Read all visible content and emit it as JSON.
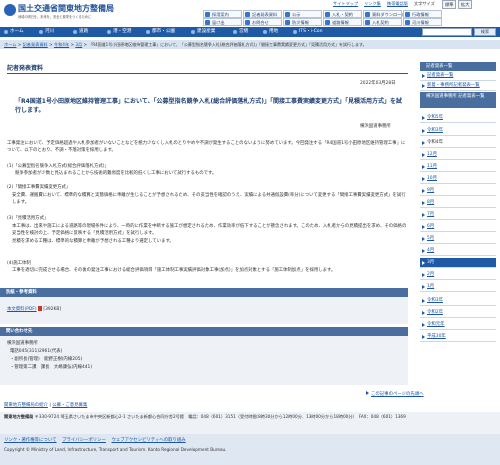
{
  "header": {
    "org_name": "国土交通省関東地方整備局",
    "tagline": "地域の明日を。未来を。安全と繁栄をつくるために",
    "util_links": [
      "サイトマップ",
      "リンク集",
      "携帯電話版"
    ],
    "font_size_label": "文字サイズ",
    "font_size_buttons": [
      "標準",
      "拡大"
    ],
    "buttons": [
      "採用案内",
      "記者発表資料",
      "公示",
      "入札・契約",
      "資料ダウンロード",
      "行政情報",
      "届け出",
      "お問合せ",
      "防災情報",
      "道路情報",
      "入札契約",
      "河川情報"
    ]
  },
  "nav": {
    "items": [
      "ホーム",
      "河川",
      "道路",
      "港・空港",
      "都市・公園",
      "建設産業",
      "営繕",
      "用地",
      "ITS・i-Con"
    ],
    "search_button": "検索"
  },
  "breadcrumb": [
    "ホーム",
    "記者発表資料",
    "令和4年",
    "3月",
    "「R4国道1号小田原地区維持管理工事」において、「公募型指名競争入札(総合評価落札方式)」「間接工事費実績変更方式」「見積活用方式」を試行します。"
  ],
  "main": {
    "section_title": "記者発表資料",
    "date": "2022年03月28日",
    "title": "「R4国道1号小田原地区維持管理工事」において、「公募型指名競争入札(総合評価落札方式)」「間接工事費実績変更方式」「見積活用方式」を試行します。",
    "office": "横浜国道事務所",
    "intro": "工事発注において、予定価格超過や入札参加者がいないことなどを極力少なくし入札のとりやめや不調が発生することのないように努めています。今回発注する「R4国道1号小田原地区維持管理工事」について、以下のとおり、不調・不落対策を採用します。",
    "items": [
      {
        "heading": "(1)「公募型指名競争入札方式(総合評価落札方式)」",
        "body": "競争参加者が少数と見込まれることから技術的難易度を比較的低くし工事において試行するものです。"
      },
      {
        "heading": "(2)「間接工事費実績変更方式」",
        "body": "安全費、運搬費において、標準的な積算と実態価格に乖離が生じることが予想されるため、その妥当性を確認のうえ、実績による共通仮設費(率分)について変更する「間接工事費実績変更方式」を試行します。"
      },
      {
        "heading": "(3)「見積活用方式」",
        "body": "本工事は、出来や施工による道路等の現場条件により、一時的に作業を中断する施工が想定されるため、作業効率が低下することが懸念されます。このため、入札者からの見積提出を求め、その価格の妥当性を検討の上、予定価格に反映する「見積活用方式」を試行します。",
        "body2": "見積を求める工種は、標準的な積算と乖離が予想される工種より選定しています。"
      },
      {
        "heading": "(4)施工体制",
        "body": "工事を適切に完成させる場合、その後の発注工事における総合評価項目「施工体制工事実績評価対象工事(加点)」を加点対象とする「施工体制加点」を採用します。"
      }
    ],
    "attach_header": "別紙・参考資料",
    "attach_link": "本文資料(PDF)",
    "attach_size": "[392KB]",
    "contact_header": "問い合わせ先",
    "contact_org": "横浜国道事務所",
    "contact_tel": "電話045(311)2961(代表)",
    "contact_lines": [
      "・副所長(管理)　能野正樹(内線205)",
      "・管理第二課　課長　大嶋康弘(内線441)"
    ],
    "back_link": "この記事のページの先頭へ",
    "related_links": [
      "関東地方整備局の紹介",
      "公募・ご意見募集"
    ]
  },
  "sidebar": {
    "header1": "記者発表一覧",
    "items_top": [
      "記者発表一覧",
      "新着・事務所記者発表一覧"
    ],
    "header2": "横浜国道事務所 記者発表一覧",
    "years": [
      "令和5年",
      "令和3年"
    ],
    "current_year": "令和4年",
    "months": [
      "12月",
      "11月",
      "10月",
      "9月",
      "8月",
      "7月",
      "6月",
      "5月",
      "4月",
      "3月",
      "2月",
      "1月"
    ],
    "active_month": "3月",
    "years_bottom": [
      "令和3年",
      "令和2年",
      "令和元年",
      "平成30年"
    ]
  },
  "footer": {
    "org": "関東地方整備局",
    "address": "〒330-9724 埼玉県さいたま市中央区新都心2-1 さいたま新都心合同庁舎2号館　電話：048（601）3151（受付時間:8時30分から12時00分、13時00分から18時00分）　FAX：048（601）1369",
    "links": [
      "リンク・著作権等について",
      "プライバシーポリシー",
      "ウェブアクセシビリティへの取り組み"
    ],
    "copyright": "Copyright © Ministry of Land, Infrastructure, Transport and Tourism. Kanto Regional Development Bureau."
  },
  "colors": {
    "brand": "#1f5aa6",
    "accent": "#4a6ea0",
    "link": "#1a55a6"
  }
}
